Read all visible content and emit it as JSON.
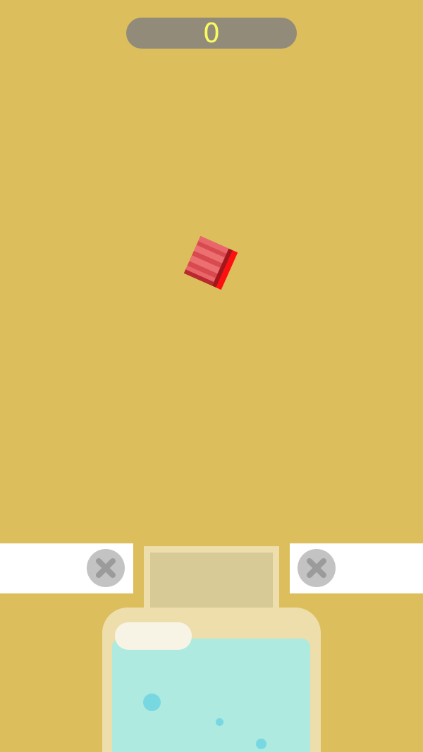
{
  "hud": {
    "score": "0"
  },
  "colors": {
    "background": "#dcbe5c",
    "score_pill": "#928b79",
    "score_text": "#fafa63",
    "block": "#d84a4e",
    "block_accent": "#ff0000",
    "panel": "#ffffff",
    "close_button": "#c3c3c3",
    "jar": "#eddeac",
    "jar_lid": "#d7ca97",
    "water": "#aeeadf",
    "bubble": "#78d8e2"
  },
  "game_objects": {
    "falling_block": {
      "icon": "red-striped-block"
    },
    "left_panel": {
      "button_icon": "close-icon"
    },
    "right_panel": {
      "button_icon": "close-icon"
    },
    "jar": {
      "contents": "water"
    }
  }
}
